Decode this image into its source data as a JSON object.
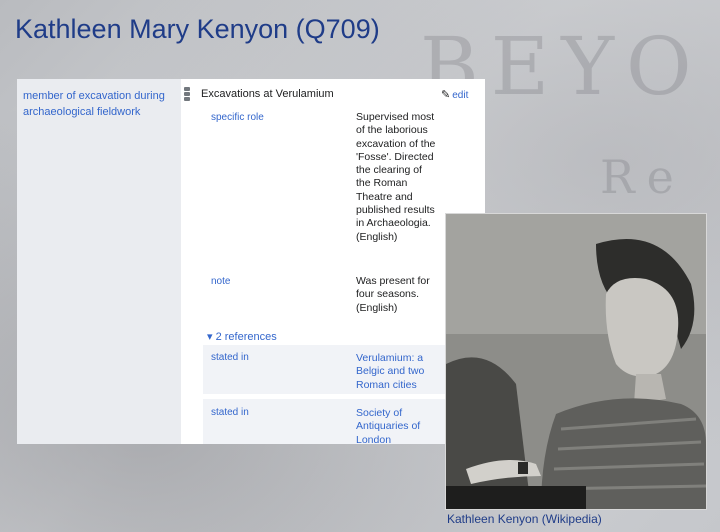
{
  "slide": {
    "title": "Kathleen Mary Kenyon (Q709)",
    "background_words": [
      "BEYO",
      "Re"
    ]
  },
  "statement": {
    "property": "member of excavation during archaeological fieldwork",
    "value": "Excavations at Verulamium",
    "edit_label": "edit",
    "qualifiers": [
      {
        "label": "specific role",
        "value": "Supervised most of the laborious excavation of the 'Fosse'. Directed the clearing of the Roman Theatre and published results in Archaeologia. (English)"
      },
      {
        "label": "note",
        "value": "Was present for four seasons. (English)"
      }
    ],
    "references_toggle": "2 references",
    "references": [
      {
        "label": "stated in",
        "value": "Verulamium: a Belgic and two Roman cities"
      },
      {
        "label": "stated in",
        "value": "Society of Antiquaries of London"
      }
    ]
  },
  "photo": {
    "caption": "Kathleen Kenyon (Wikipedia)"
  },
  "colors": {
    "title": "#1f3c88",
    "link": "#3366cc",
    "property_bg": "#eaecf0"
  },
  "icons": [
    "rank-normal-icon",
    "pencil-icon",
    "triangle-down-icon"
  ]
}
